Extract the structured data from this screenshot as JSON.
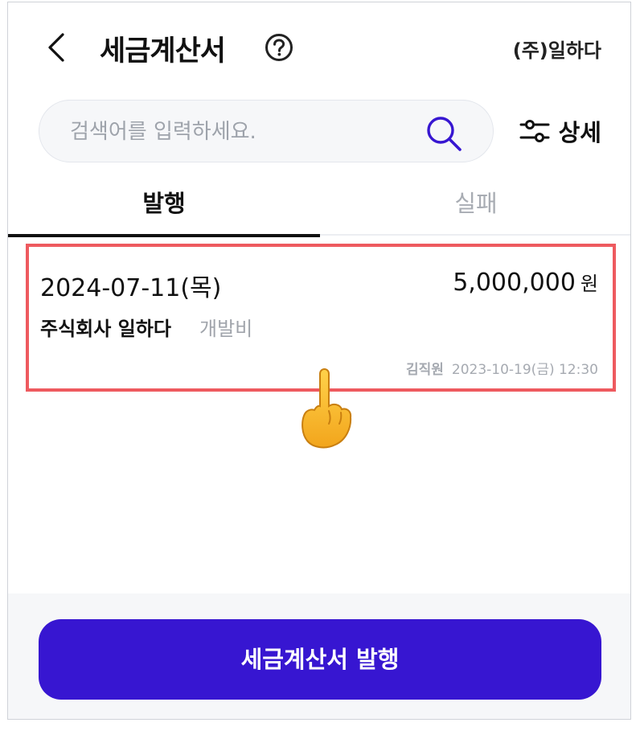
{
  "header": {
    "title": "세금계산서",
    "company": "(주)일하다",
    "back_icon": "chevron-left-icon",
    "help_icon": "question-circle-icon"
  },
  "search": {
    "placeholder": "검색어를 입력하세요.",
    "value": "",
    "icon": "search-icon",
    "detail_label": "상세",
    "detail_icon": "sliders-icon"
  },
  "tabs": [
    {
      "label": "발행",
      "active": true
    },
    {
      "label": "실패",
      "active": false
    }
  ],
  "invoices": [
    {
      "date": "2024-07-11(목)",
      "amount": "5,000,000",
      "unit": "원",
      "company": "주식회사 일하다",
      "category": "개발비",
      "author": "김직원",
      "timestamp": "2023-10-19(금) 12:30"
    }
  ],
  "footer": {
    "issue_button_label": "세금계산서 발행"
  },
  "colors": {
    "accent": "#3716d1",
    "highlight_border": "#ee5a5f",
    "muted_text": "#a0a4ab"
  }
}
